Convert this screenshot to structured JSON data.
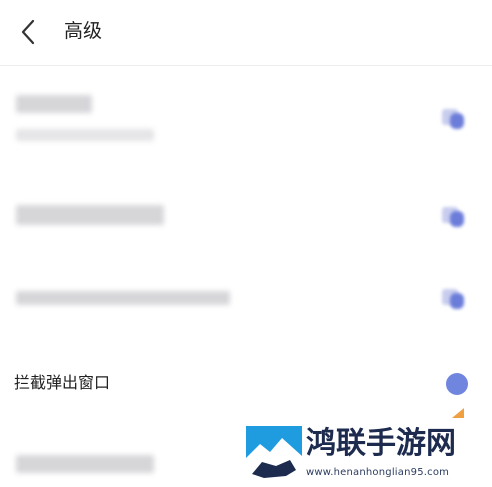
{
  "header": {
    "title": "高级",
    "back_icon": "chevron-left-icon"
  },
  "rows": [
    {
      "id": "row-1",
      "label": "",
      "control": "toggle-icon"
    },
    {
      "id": "row-2",
      "label": "",
      "control": "toggle-icon"
    },
    {
      "id": "row-3",
      "label": "",
      "control": "toggle-icon"
    },
    {
      "id": "row-4",
      "label": "拦截弹出窗口",
      "control": "radio-dot-icon"
    },
    {
      "id": "row-5",
      "label": "",
      "control": ""
    }
  ],
  "watermark": {
    "name": "鸿联手游网",
    "url": "www.henanhonglian95.com"
  },
  "colors": {
    "accent": "#6f85de",
    "text": "#222222",
    "divider": "#ededed",
    "watermark": "#1d2b4f"
  }
}
